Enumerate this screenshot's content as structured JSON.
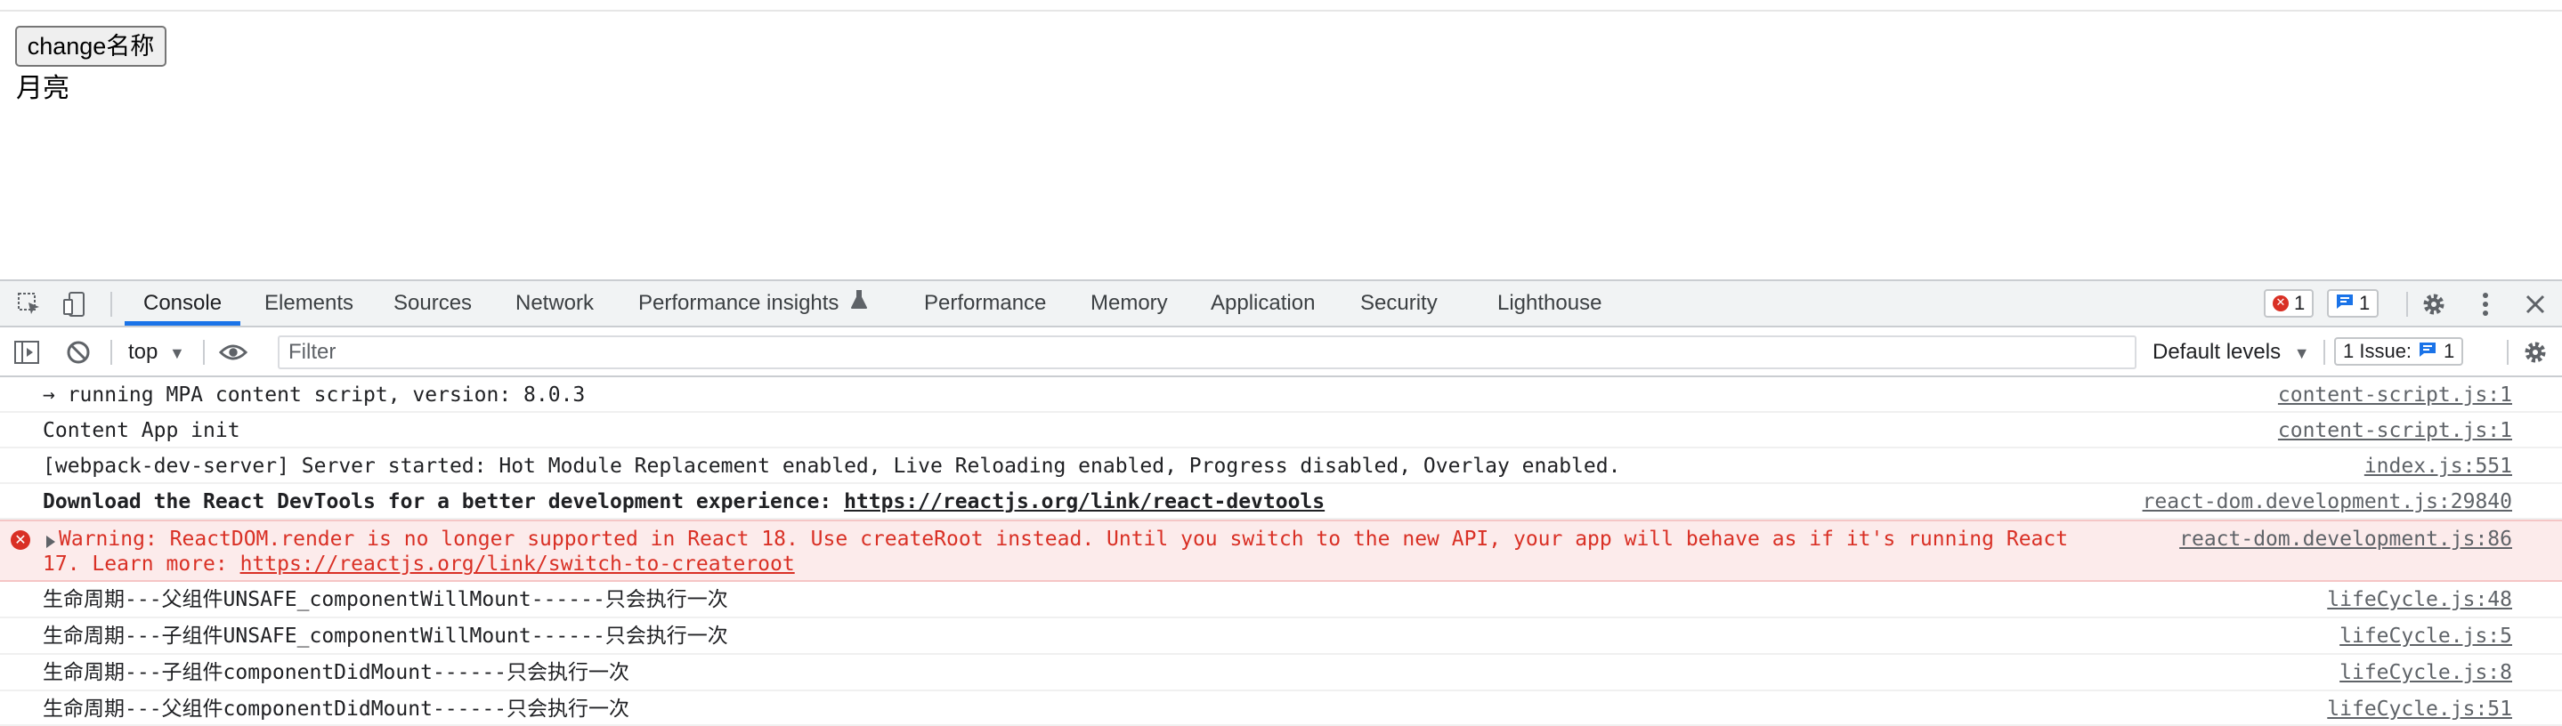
{
  "page": {
    "button_label": "change名称",
    "text": "月亮"
  },
  "devtools": {
    "tabs": [
      {
        "label": "Console",
        "active": true
      },
      {
        "label": "Elements"
      },
      {
        "label": "Sources"
      },
      {
        "label": "Network"
      },
      {
        "label": "Performance insights",
        "icon": "flask-icon"
      },
      {
        "label": "Performance"
      },
      {
        "label": "Memory"
      },
      {
        "label": "Application"
      },
      {
        "label": "Security"
      },
      {
        "label": "Lighthouse"
      }
    ],
    "error_count": "1",
    "message_count": "1",
    "toolbar": {
      "context": "top",
      "filter_placeholder": "Filter",
      "default_levels": "Default levels",
      "issues_label": "1 Issue:",
      "issues_count": "1"
    },
    "console": [
      {
        "text": "→ running MPA content script, version: 8.0.3",
        "source": "content-script.js:1"
      },
      {
        "text": "Content App init",
        "source": "content-script.js:1"
      },
      {
        "text": "[webpack-dev-server] Server started: Hot Module Replacement enabled, Live Reloading enabled, Progress disabled, Overlay enabled.",
        "source": "index.js:551"
      },
      {
        "text_prefix": "Download the React DevTools for a better development experience: ",
        "link": "https://reactjs.org/link/react-devtools",
        "source": "react-dom.development.js:29840"
      },
      {
        "text": "Warning: ReactDOM.render is no longer supported in React 18. Use createRoot instead. Until you switch to the new API, your app will behave as if it's running React",
        "text_line2_prefix": "17. Learn more: ",
        "link": "https://reactjs.org/link/switch-to-createroot",
        "source": "react-dom.development.js:86"
      },
      {
        "text": "生命周期---父组件UNSAFE_componentWillMount------只会执行一次",
        "source": "lifeCycle.js:48"
      },
      {
        "text": "生命周期---子组件UNSAFE_componentWillMount------只会执行一次",
        "source": "lifeCycle.js:5"
      },
      {
        "text": "生命周期---子组件componentDidMount------只会执行一次",
        "source": "lifeCycle.js:8"
      },
      {
        "text": "生命周期---父组件componentDidMount------只会执行一次",
        "source": "lifeCycle.js:51"
      }
    ],
    "colors": {
      "accent": "#1a73e8",
      "error": "#d93025",
      "warning_bg": "#fcebeb"
    }
  }
}
